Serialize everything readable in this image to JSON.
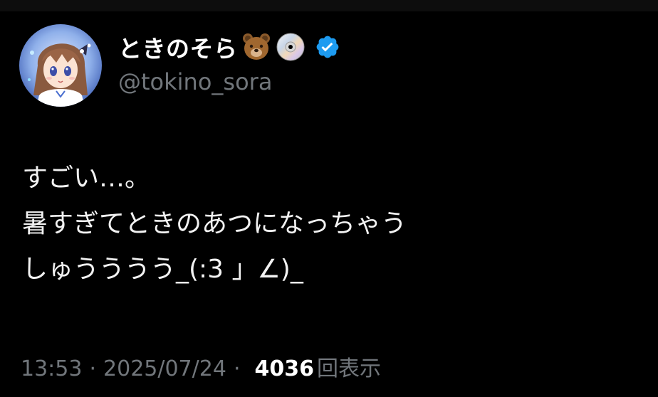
{
  "author": {
    "display_name": "ときのそら",
    "handle": "@tokino_sora",
    "name_emojis": [
      "bear-icon",
      "dvd-icon"
    ],
    "verified_icon": "verified-badge-icon",
    "verified_color": "#1d9bf0"
  },
  "tweet": {
    "lines": [
      "すごい…。",
      "暑すぎてときのあつになっちゃう",
      "しゅうううう_(:3 」∠)_"
    ]
  },
  "meta": {
    "time": "13:53",
    "separator": "·",
    "date": "2025/07/24",
    "views_count": "4036",
    "views_label": "回表示"
  },
  "colors": {
    "background": "#000000",
    "text": "#f2f2f2",
    "muted": "#71767b",
    "accent": "#1d9bf0"
  }
}
